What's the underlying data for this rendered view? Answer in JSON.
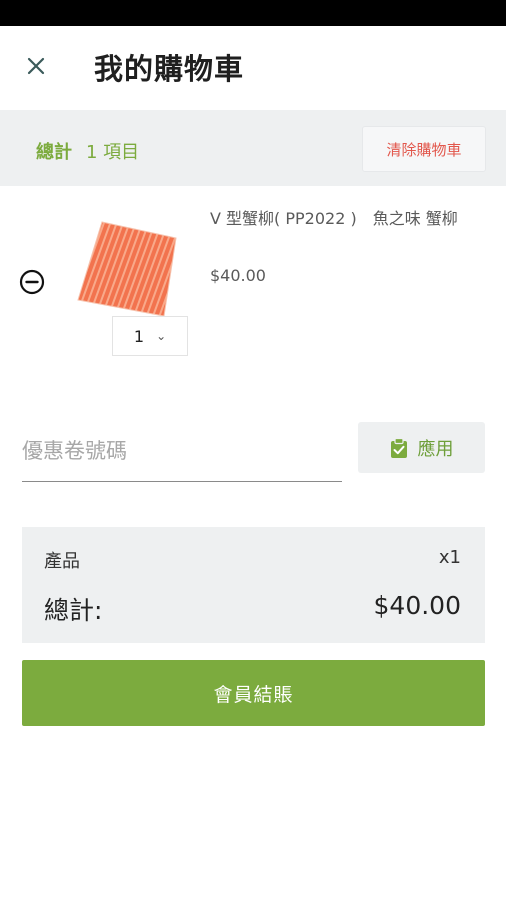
{
  "header": {
    "title": "我的購物車",
    "close_icon": "close-icon"
  },
  "summary": {
    "total_label": "總計",
    "item_count": "1 項目",
    "clear_label": "清除購物車"
  },
  "cart": {
    "items": [
      {
        "name": "V 型蟹柳( PP2022 )　魚之味 蟹柳",
        "price": "$40.00",
        "quantity": "1",
        "remove_icon": "minus-circle-icon",
        "image": "product-image"
      }
    ]
  },
  "coupon": {
    "placeholder": "優惠卷號碼",
    "value": "",
    "apply_label": "應用",
    "apply_icon": "clipboard-check-icon"
  },
  "totals": {
    "products_label": "產品",
    "products_value": "x1",
    "total_label": "總計:",
    "total_value": "$40.00"
  },
  "checkout": {
    "label": "會員結賬"
  },
  "colors": {
    "accent": "#7cab3e",
    "danger": "#e2574c",
    "panel": "#eef0f1"
  }
}
